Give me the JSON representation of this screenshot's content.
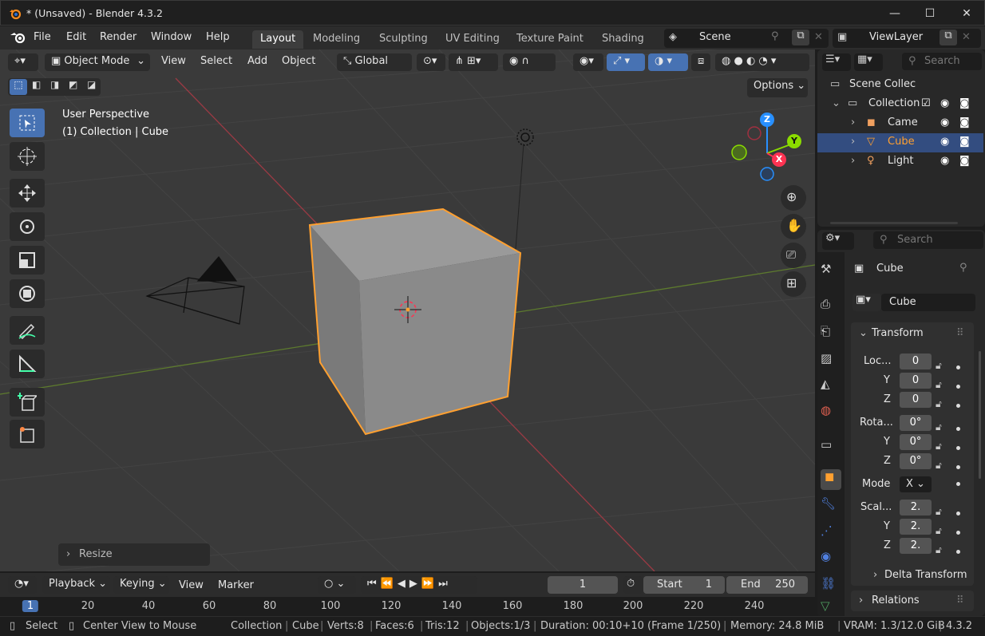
{
  "window": {
    "title": "* (Unsaved) - Blender 4.3.2"
  },
  "menu": [
    "File",
    "Edit",
    "Render",
    "Window",
    "Help"
  ],
  "workspaces": [
    "Layout",
    "Modeling",
    "Sculpting",
    "UV Editing",
    "Texture Paint",
    "Shading"
  ],
  "scene": "Scene",
  "view_layer": "ViewLayer",
  "viewport_header": {
    "mode": "Object Mode",
    "view": "View",
    "select": "Select",
    "add": "Add",
    "object": "Object",
    "orientation": "Global",
    "options": "Options"
  },
  "viewport": {
    "perspective": "User Perspective",
    "context": "(1) Collection | Cube",
    "gizmo": {
      "x": "X",
      "y": "Y",
      "z": "Z"
    },
    "operator_panel": "Resize"
  },
  "outliner": {
    "search": "Search",
    "root": "Scene Collec",
    "collection": "Collection",
    "items": [
      "Came",
      "Cube",
      "Light"
    ]
  },
  "properties": {
    "search": "Search",
    "object_name": "Cube",
    "data_name": "Cube",
    "transform": "Transform",
    "location": {
      "label": "Loc...",
      "x": "0",
      "y": "0",
      "z": "0"
    },
    "rotation": {
      "label": "Rota...",
      "x": "0°",
      "y": "0°",
      "z": "0°"
    },
    "mode": {
      "label": "Mode",
      "value": "X"
    },
    "scale": {
      "label": "Scal...",
      "x": "2.",
      "y": "2.",
      "z": "2."
    },
    "axis_y": "Y",
    "axis_z": "Z",
    "delta": "Delta Transform",
    "relations": "Relations"
  },
  "timeline": {
    "playback": "Playback",
    "keying": "Keying",
    "view": "View",
    "marker": "Marker",
    "frame": "1",
    "start_label": "Start",
    "start": "1",
    "end_label": "End",
    "end": "250",
    "ruler": [
      "1",
      "20",
      "40",
      "60",
      "80",
      "100",
      "120",
      "140",
      "160",
      "180",
      "200",
      "220",
      "240"
    ]
  },
  "status": {
    "select": "Select",
    "center": "Center View to Mouse",
    "collection": "Collection",
    "object": "Cube",
    "verts": "Verts:8",
    "faces": "Faces:6",
    "tris": "Tris:12",
    "objects": "Objects:1/3",
    "duration": "Duration: 00:10+10 (Frame 1/250)",
    "memory": "Memory: 24.8 MiB",
    "vram": "VRAM: 1.3/12.0 GiB",
    "version": "4.3.2"
  },
  "colors": {
    "accent": "#4772b3",
    "selection": "#ffa030",
    "x_axis": "#ff3352",
    "y_axis": "#8bdc00",
    "z_axis": "#2890ff"
  }
}
